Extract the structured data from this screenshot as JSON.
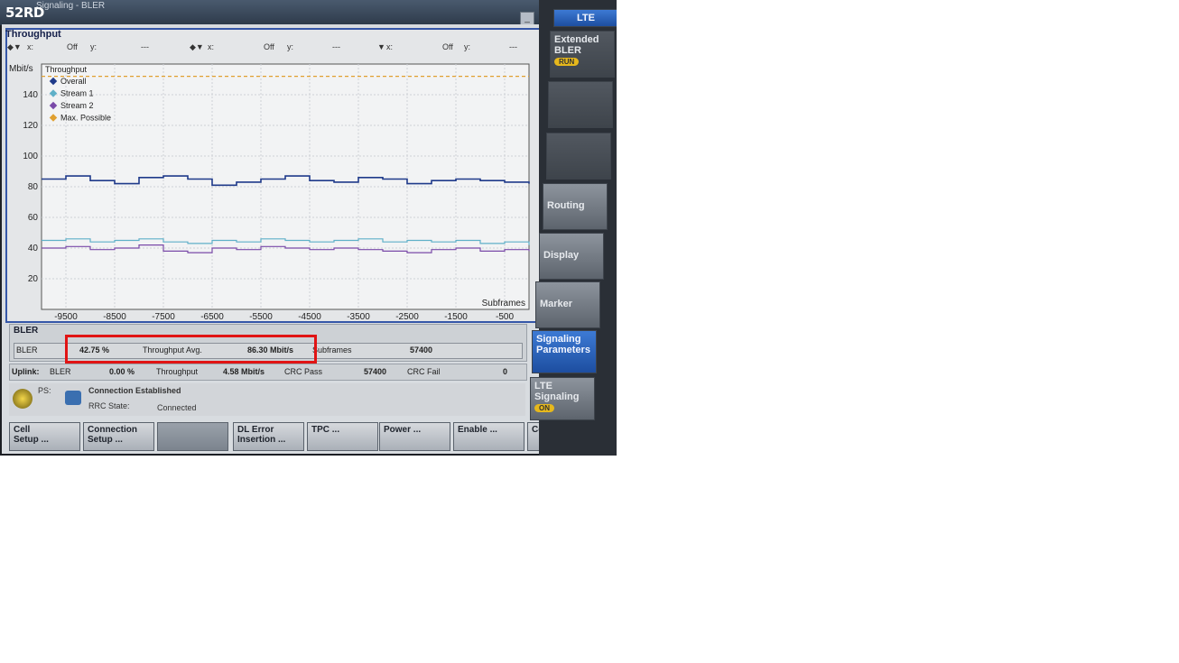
{
  "watermark": "52RD",
  "window": {
    "title": "Signaling - BLER",
    "min_icon": "minimize-icon",
    "close_icon": "close-icon"
  },
  "chart_panel": {
    "title": "Throughput",
    "markers": [
      {
        "icon": "marker-1-icon",
        "x_label": "x:",
        "x_value": "Off",
        "y_label": "y:",
        "y_value": "---"
      },
      {
        "icon": "marker-2-icon",
        "x_label": "x:",
        "x_value": "Off",
        "y_label": "y:",
        "y_value": "---"
      },
      {
        "icon": "marker-3-icon",
        "x_label": "x:",
        "x_value": "Off",
        "y_label": "y:",
        "y_value": "---"
      }
    ]
  },
  "chart_data": {
    "type": "line",
    "title": "",
    "ylabel": "Mbit/s",
    "xlabel": "Subframes",
    "ylim": [
      0,
      160
    ],
    "xlim": [
      -10000,
      0
    ],
    "yticks": [
      20,
      40,
      60,
      80,
      100,
      120,
      140
    ],
    "xticks": [
      -9500,
      -8500,
      -7500,
      -6500,
      -5500,
      -4500,
      -3500,
      -2500,
      -1500,
      -500
    ],
    "grid": true,
    "legend": {
      "title": "Throughput",
      "placement": "top-left"
    },
    "x": [
      -10000,
      -9500,
      -9000,
      -8500,
      -8000,
      -7500,
      -7000,
      -6500,
      -6000,
      -5500,
      -5000,
      -4500,
      -4000,
      -3500,
      -3000,
      -2500,
      -2000,
      -1500,
      -1000,
      -500,
      0
    ],
    "series": [
      {
        "name": "Overall",
        "color": "#1f3a8a",
        "values": [
          85,
          87,
          84,
          82,
          86,
          87,
          85,
          81,
          83,
          85,
          87,
          84,
          83,
          86,
          85,
          82,
          84,
          85,
          84,
          83,
          82
        ]
      },
      {
        "name": "Stream 1",
        "color": "#5fb0c8",
        "values": [
          45,
          46,
          44,
          45,
          46,
          44,
          43,
          45,
          44,
          46,
          45,
          44,
          45,
          46,
          44,
          45,
          44,
          45,
          43,
          44,
          42
        ]
      },
      {
        "name": "Stream 2",
        "color": "#7a4aa8",
        "values": [
          40,
          41,
          39,
          40,
          42,
          38,
          37,
          40,
          39,
          41,
          40,
          39,
          40,
          39,
          38,
          37,
          39,
          40,
          38,
          39,
          38
        ]
      },
      {
        "name": "Max. Possible",
        "color": "#e0a030",
        "values": [
          152,
          152,
          152,
          152,
          152,
          152,
          152,
          152,
          152,
          152,
          152,
          152,
          152,
          152,
          152,
          152,
          152,
          152,
          152,
          152,
          152
        ]
      }
    ]
  },
  "bler": {
    "heading": "BLER",
    "bler_label": "BLER",
    "bler_value": "42.75 %",
    "tp_label": "Throughput Avg.",
    "tp_value": "86.30 Mbit/s",
    "sf_label": "Subframes",
    "sf_value": "57400"
  },
  "uplink": {
    "label": "Uplink:",
    "bler_label": "BLER",
    "bler_value": "0.00 %",
    "tp_label": "Throughput",
    "tp_value": "4.58 Mbit/s",
    "crc_pass_label": "CRC Pass",
    "crc_pass_value": "57400",
    "crc_fail_label": "CRC Fail",
    "crc_fail_value": "0"
  },
  "status": {
    "ps_label": "PS:",
    "connection": "Connection Established",
    "rrc_label": "RRC State:",
    "rrc_value": "Connected"
  },
  "softkeys": [
    {
      "label": "Cell\nSetup ..."
    },
    {
      "label": "Connection\nSetup ..."
    },
    {
      "label": ""
    },
    {
      "label": "DL Error\nInsertion ..."
    },
    {
      "label": "TPC ..."
    },
    {
      "label": "Power ..."
    },
    {
      "label": "Enable ..."
    },
    {
      "label": "Config ..."
    }
  ],
  "sidebar": {
    "top_tab": "LTE",
    "ext_bler": "Extended BLER",
    "ext_bler_tag": "RUN",
    "routing": "Routing",
    "display": "Display",
    "marker": "Marker",
    "signaling_params": "Signaling Parameters",
    "lte_signaling": "LTE Signaling",
    "lte_signaling_tag": "ON"
  }
}
